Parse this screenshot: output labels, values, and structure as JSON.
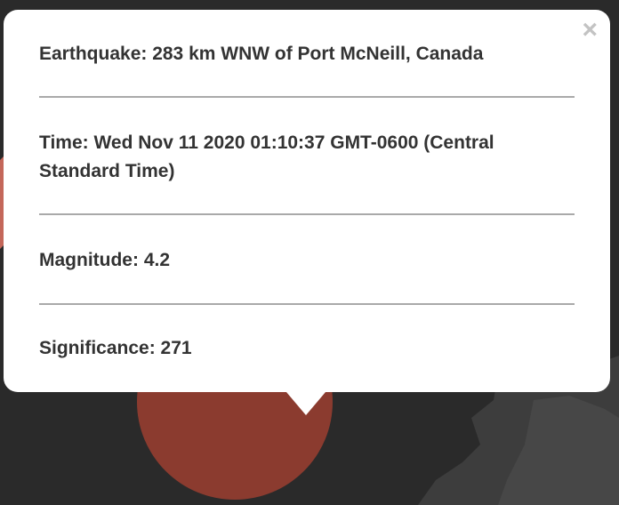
{
  "popup": {
    "close_label": "×",
    "earthquake": "Earthquake: 283 km WNW of Port McNeill, Canada",
    "time": "Time: Wed Nov 11 2020 01:10:37 GMT-0600 (Central Standard Time)",
    "magnitude": "Magnitude: 4.2",
    "significance": "Significance: 271"
  },
  "colors": {
    "map_background": "#2a2a2a",
    "land": "#4a4a4a",
    "marker": "#b5463a"
  }
}
